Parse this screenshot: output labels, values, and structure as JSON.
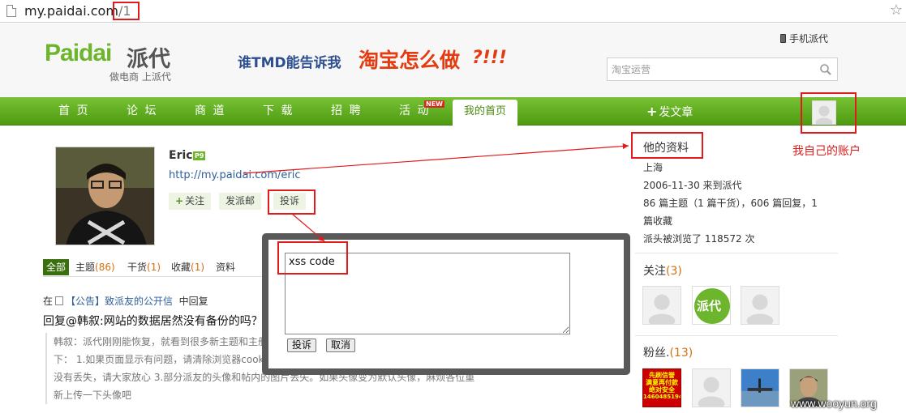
{
  "browser": {
    "url_host": "my.paidai.com",
    "url_path": "/1"
  },
  "header": {
    "logo_en": "Paidai",
    "logo_cn": "派代",
    "slogan": "做电商 上派代",
    "banner_text_1": "谁TMD能告诉我",
    "banner_text_2": "淘宝怎么做",
    "banner_text_3": "?!!!",
    "mobile_link": "手机派代",
    "search_placeholder": "淘宝运营"
  },
  "nav": {
    "items": [
      "首 页",
      "论 坛",
      "商 道",
      "下 载",
      "招 聘",
      "活 动"
    ],
    "new_badge": "NEW",
    "active_item": "我的首页",
    "post_button": "发文章",
    "post_plus": "+"
  },
  "profile": {
    "name": "Eric",
    "level": "P9",
    "url": "http://my.paidai.com/eric",
    "follow_plus": "+",
    "follow": "关注",
    "message": "发派邮",
    "report": "投诉"
  },
  "tabs": [
    {
      "label": "全部",
      "count": ""
    },
    {
      "label": "主题",
      "count": "(86)"
    },
    {
      "label": "干货",
      "count": "(1)"
    },
    {
      "label": "收藏",
      "count": "(1)"
    },
    {
      "label": "资料",
      "count": ""
    }
  ],
  "feed": {
    "prefix": "在",
    "topic": "【公告】致派友的公开信",
    "suffix": "中回复",
    "title": "回复@韩叙:网站的数据居然没有备份的吗？这",
    "quote_lines": [
      "韩叙：派代刚刚能恢复，就看到很多新主题和主册",
      "下：  1.如果页面显示有问题，请清除浏览器cookie",
      "没有丢失，请大家放心 3.部分派友的头像和帖内的图片丢失。如果头像变为默认头像，麻烦各位重",
      "新上传一下头像吧"
    ]
  },
  "modal": {
    "textarea_value": "xss code",
    "submit": "投诉",
    "cancel": "取消"
  },
  "sidebar": {
    "title": "他的资料",
    "location": "上海",
    "joined": "2006-11-30 来到派代",
    "stats_line1": "86 篇主题（1 篇干货），606 篇回复，1",
    "stats_line2": "篇收藏",
    "views": "派头被浏览了 118572 次",
    "following_label": "关注",
    "following_count": "(3)",
    "fans_label": "粉丝.",
    "fans_count": "(13)",
    "paidai_avatar_text": "派代",
    "ad_avatar_lines": [
      "先刷信誉",
      "满意再付款",
      "绝对安全",
      "1460485194"
    ]
  },
  "annotation": {
    "my_account": "我自己的账户"
  },
  "watermark": "www.wooyun.org",
  "colors": {
    "nav_green": "#5fae20",
    "annotation_red": "#e01b1b",
    "link_blue": "#2e5f9a",
    "count_orange": "#d46f10"
  }
}
